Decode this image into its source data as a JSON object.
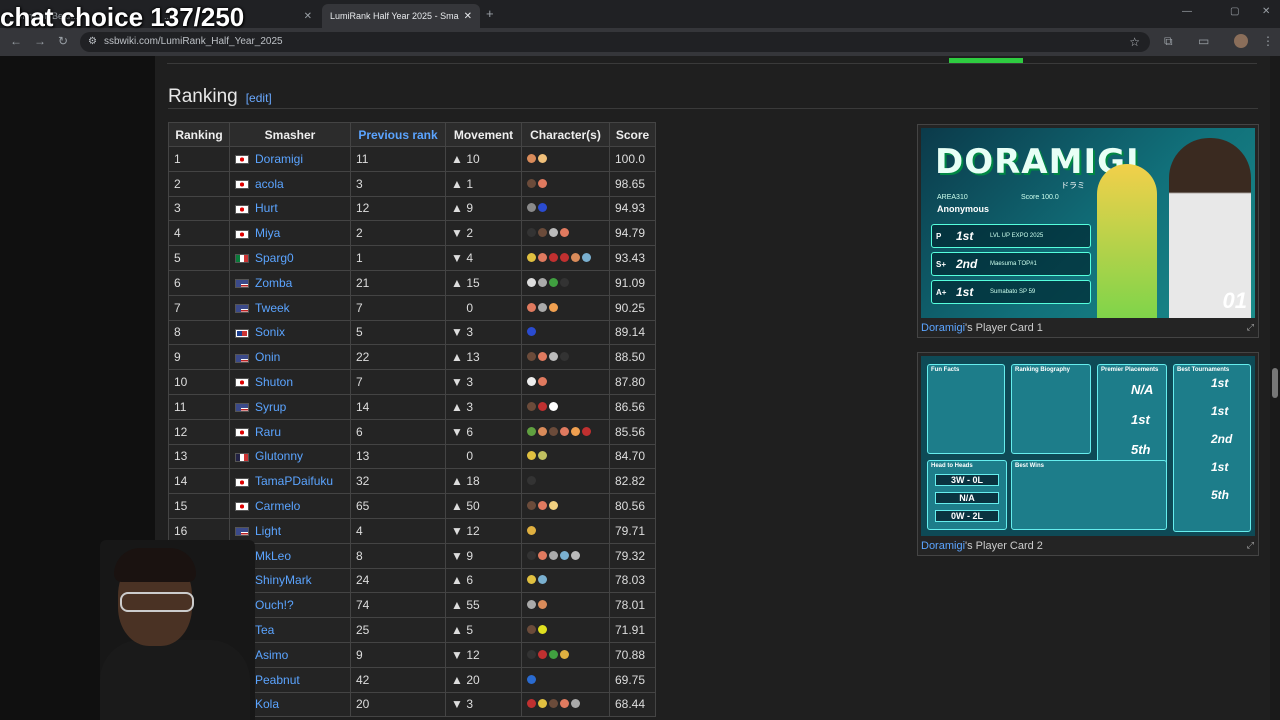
{
  "overlay": {
    "stream_text": "chat choice 137/250"
  },
  "browser": {
    "tabs": [
      {
        "label": "Crimson Bean...",
        "active": false
      },
      {
        "label": "...",
        "active": false
      },
      {
        "label": "LumiRank Half Year 2025 - Sma",
        "active": true
      }
    ],
    "url": "ssbwiki.com/LumiRank_Half_Year_2025"
  },
  "section": {
    "title": "Ranking",
    "edit_label": "[edit]"
  },
  "table": {
    "headers": [
      "Ranking",
      "Smasher",
      "Previous rank",
      "Movement",
      "Character(s)",
      "Score"
    ],
    "rows": [
      {
        "rank": "1",
        "flag": "jp",
        "name": "Doramigi",
        "prev": "11",
        "dir": "up",
        "move": "10",
        "chars": [
          "#d98b5a",
          "#f0c07a"
        ],
        "score": "100.0"
      },
      {
        "rank": "2",
        "flag": "jp",
        "name": "acola",
        "prev": "3",
        "dir": "up",
        "move": "1",
        "chars": [
          "#6b4b3a",
          "#e07a5f"
        ],
        "score": "98.65"
      },
      {
        "rank": "3",
        "flag": "jp",
        "name": "Hurt",
        "prev": "12",
        "dir": "up",
        "move": "9",
        "chars": [
          "#8a8a8a",
          "#2a4bd0"
        ],
        "score": "94.93"
      },
      {
        "rank": "4",
        "flag": "jp",
        "name": "Miya",
        "prev": "2",
        "dir": "down",
        "move": "2",
        "chars": [
          "#333",
          "#6b4b3a",
          "#bbb",
          "#e07a5f"
        ],
        "score": "94.79"
      },
      {
        "rank": "5",
        "flag": "mx",
        "name": "Sparg0",
        "prev": "1",
        "dir": "down",
        "move": "4",
        "chars": [
          "#e0c040",
          "#e07a5f",
          "#c03030",
          "#c03030",
          "#d98b5a",
          "#7ab0d0"
        ],
        "score": "93.43"
      },
      {
        "rank": "6",
        "flag": "us",
        "name": "Zomba",
        "prev": "21",
        "dir": "up",
        "move": "15",
        "chars": [
          "#ddd",
          "#aaa",
          "#40a040",
          "#333"
        ],
        "score": "91.09"
      },
      {
        "rank": "7",
        "flag": "us",
        "name": "Tweek",
        "prev": "7",
        "dir": "none",
        "move": "0",
        "chars": [
          "#e07a5f",
          "#aaa",
          "#f0a050"
        ],
        "score": "90.25"
      },
      {
        "rank": "8",
        "flag": "do",
        "name": "Sonix",
        "prev": "5",
        "dir": "down",
        "move": "3",
        "chars": [
          "#2a4bd0"
        ],
        "score": "89.14"
      },
      {
        "rank": "9",
        "flag": "us",
        "name": "Onin",
        "prev": "22",
        "dir": "up",
        "move": "13",
        "chars": [
          "#6b4b3a",
          "#e07a5f",
          "#bbb",
          "#333"
        ],
        "score": "88.50"
      },
      {
        "rank": "10",
        "flag": "jp",
        "name": "Shuton",
        "prev": "7",
        "dir": "down",
        "move": "3",
        "chars": [
          "#eee",
          "#e07a5f"
        ],
        "score": "87.80"
      },
      {
        "rank": "11",
        "flag": "us",
        "name": "Syrup",
        "prev": "14",
        "dir": "up",
        "move": "3",
        "chars": [
          "#6b4b3a",
          "#c03030",
          "#fff"
        ],
        "score": "86.56"
      },
      {
        "rank": "12",
        "flag": "jp",
        "name": "Raru",
        "prev": "6",
        "dir": "down",
        "move": "6",
        "chars": [
          "#60a040",
          "#d98b5a",
          "#6b4b3a",
          "#e07a5f",
          "#f0a050",
          "#c03030"
        ],
        "score": "85.56"
      },
      {
        "rank": "13",
        "flag": "fr",
        "name": "Glutonny",
        "prev": "13",
        "dir": "none",
        "move": "0",
        "chars": [
          "#e0c040",
          "#c0c060"
        ],
        "score": "84.70"
      },
      {
        "rank": "14",
        "flag": "jp",
        "name": "TamaPDaifuku",
        "prev": "32",
        "dir": "up",
        "move": "18",
        "chars": [
          "#333"
        ],
        "score": "82.82"
      },
      {
        "rank": "15",
        "flag": "jp",
        "name": "Carmelo",
        "prev": "65",
        "dir": "up",
        "move": "50",
        "chars": [
          "#6b4b3a",
          "#e07a5f",
          "#f0d080"
        ],
        "score": "80.56"
      },
      {
        "rank": "16",
        "flag": "us",
        "name": "Light",
        "prev": "4",
        "dir": "down",
        "move": "12",
        "chars": [
          "#e0b040"
        ],
        "score": "79.71"
      },
      {
        "rank": "17",
        "flag": "mx",
        "name": "MkLeo",
        "prev": "8",
        "dir": "down",
        "move": "9",
        "chars": [
          "#333",
          "#e07a5f",
          "#aaa",
          "#7ab0d0",
          "#bbb"
        ],
        "score": "79.32"
      },
      {
        "rank": "18",
        "flag": "ar",
        "name": "ShinyMark",
        "prev": "24",
        "dir": "up",
        "move": "6",
        "chars": [
          "#e0c040",
          "#7ab0d0"
        ],
        "score": "78.03"
      },
      {
        "rank": "19",
        "flag": "ca",
        "name": "Ouch!?",
        "prev": "74",
        "dir": "up",
        "move": "55",
        "chars": [
          "#aaa",
          "#d98b5a"
        ],
        "score": "78.01"
      },
      {
        "rank": "20",
        "flag": "jp",
        "name": "Tea",
        "prev": "25",
        "dir": "up",
        "move": "5",
        "chars": [
          "#6b4b3a",
          "#e0e020"
        ],
        "score": "71.91"
      },
      {
        "rank": "21",
        "flag": "jp",
        "name": "Asimo",
        "prev": "9",
        "dir": "down",
        "move": "12",
        "chars": [
          "#333",
          "#c03030",
          "#40a040",
          "#e0b040"
        ],
        "score": "70.88"
      },
      {
        "rank": "22",
        "flag": "us",
        "name": "Peabnut",
        "prev": "42",
        "dir": "up",
        "move": "20",
        "chars": [
          "#2a6bd0"
        ],
        "score": "69.75"
      },
      {
        "rank": "23",
        "flag": "jp",
        "name": "Kola",
        "prev": "20",
        "dir": "down",
        "move": "3",
        "chars": [
          "#c03030",
          "#e0c040",
          "#6b4b3a",
          "#e07a5f",
          "#aaa"
        ],
        "score": "68.44"
      }
    ]
  },
  "card1": {
    "caption_link": "Doramigi",
    "caption_text": "'s Player Card 1",
    "title_art": "DORAMIGI",
    "subtitle": "ドラミ",
    "handle": "AREA310",
    "sponsor": "Anonymous",
    "score": "Score 100.0",
    "rank_badge": "01",
    "placements": [
      {
        "tier": "P",
        "place": "1st",
        "event": "LVL UP EXPO 2025"
      },
      {
        "tier": "S+",
        "place": "2nd",
        "event": "Maesuma TOP#1"
      },
      {
        "tier": "A+",
        "place": "1st",
        "event": "Sumabato SP 59"
      }
    ]
  },
  "card2": {
    "caption_link": "Doramigi",
    "caption_text": "'s Player Card 2",
    "panels": [
      "Fun Facts",
      "Ranking Biography",
      "Premier Placements",
      "Best Tournaments",
      "Head to Heads",
      "Best Wins"
    ],
    "h2h": [
      "3W - 0L",
      "N/A",
      "0W - 2L"
    ],
    "premier": [
      "N/A",
      "1st",
      "5th"
    ],
    "best": [
      "1st",
      "1st",
      "2nd",
      "1st",
      "5th"
    ]
  }
}
